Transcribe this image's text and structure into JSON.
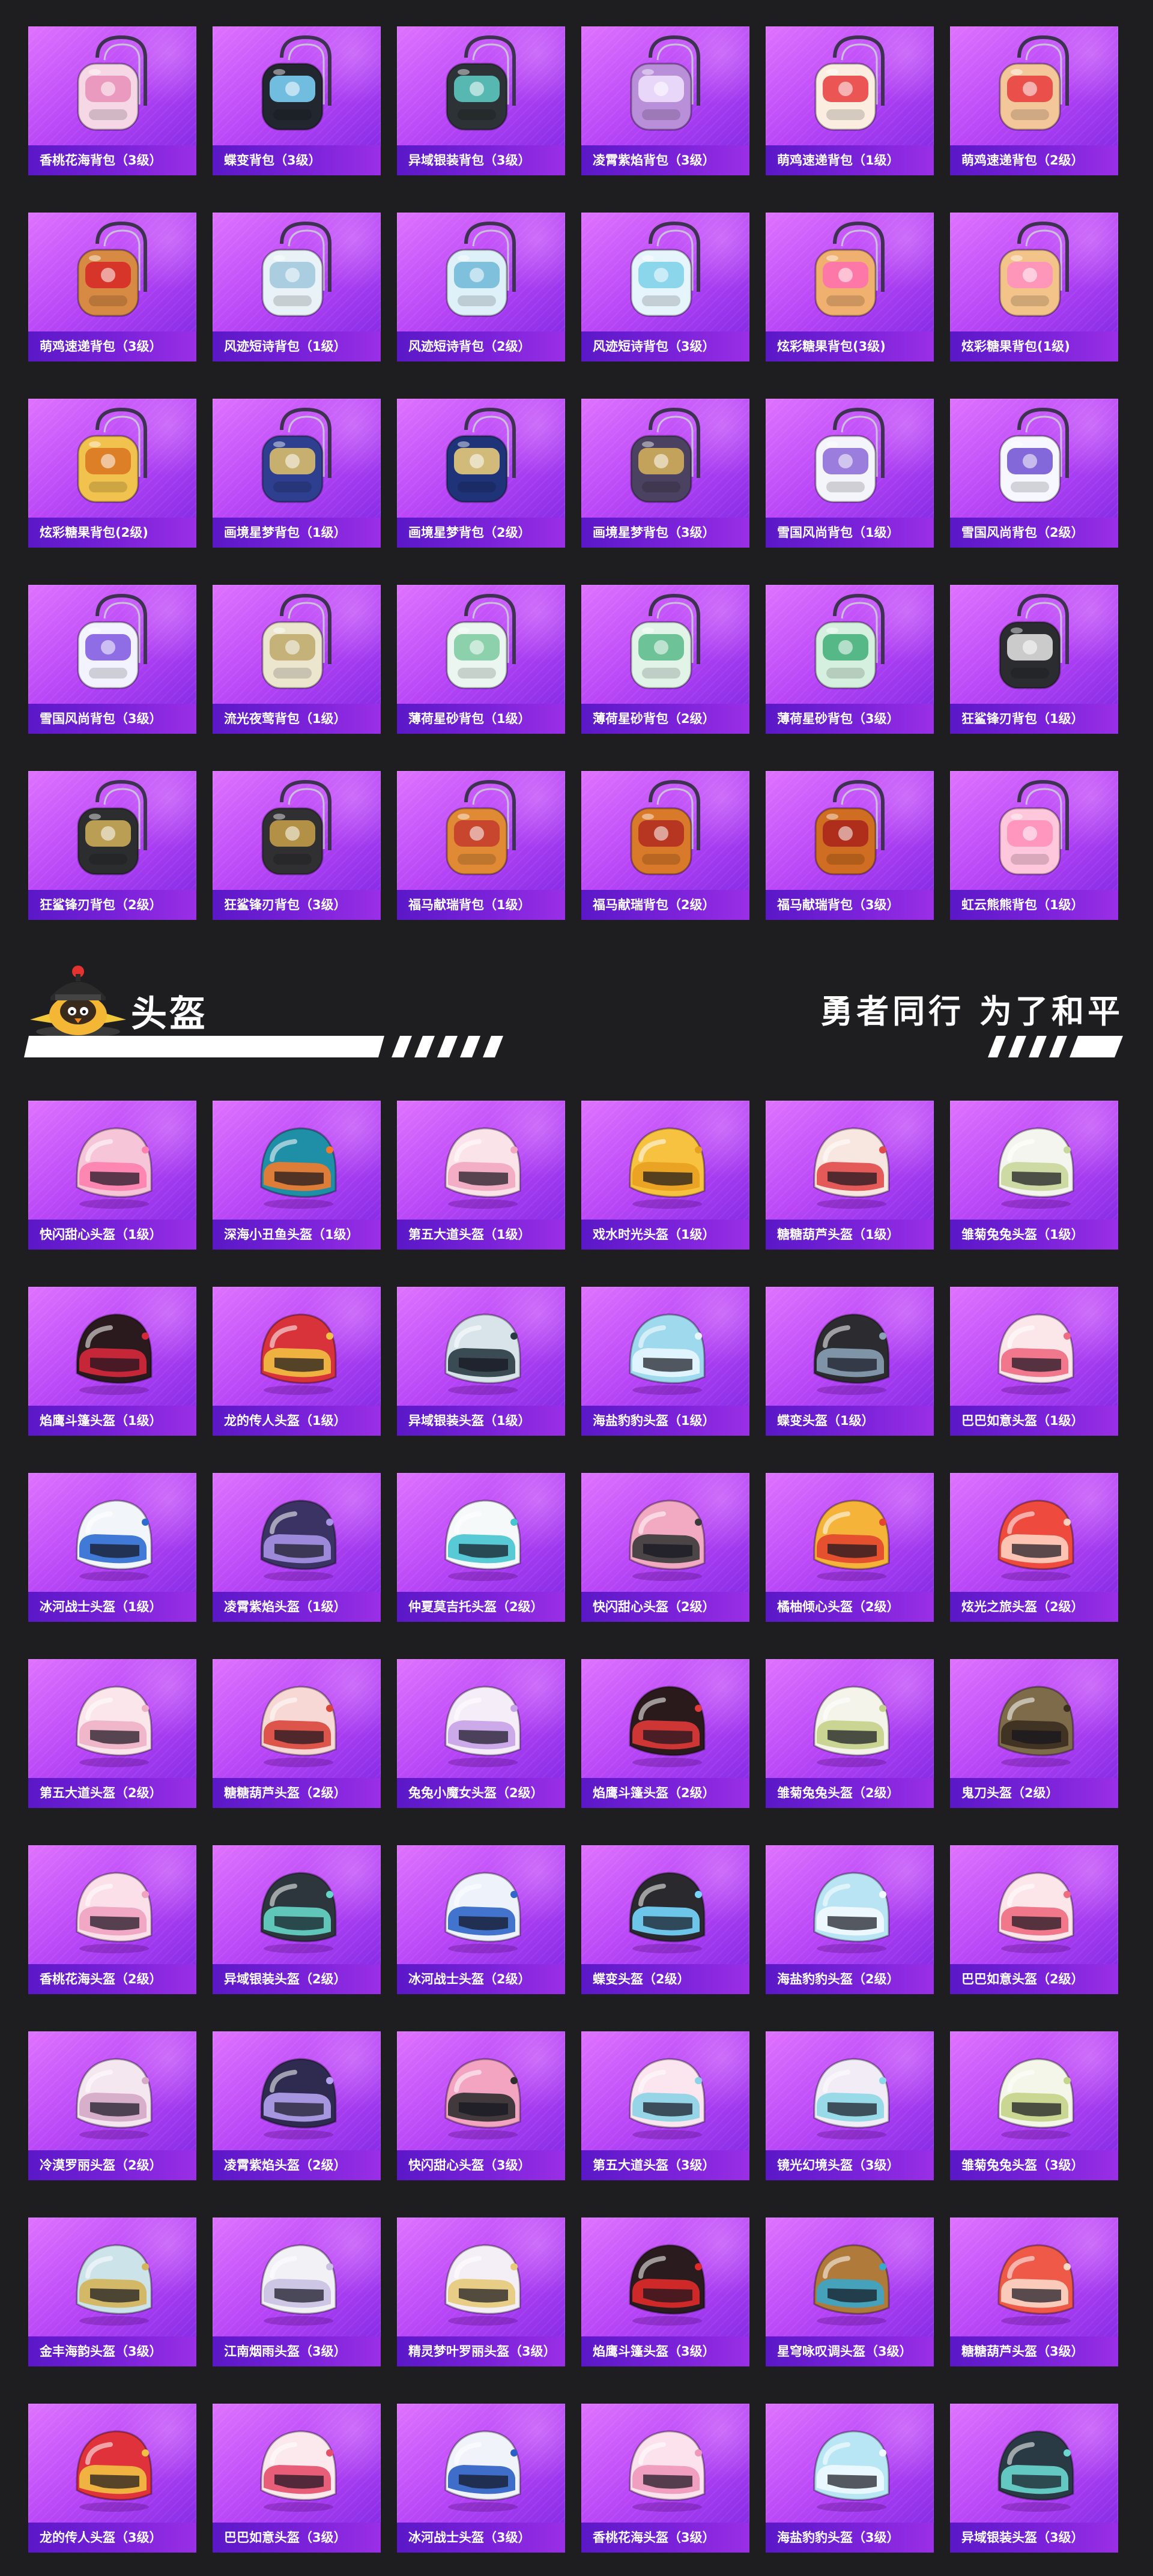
{
  "backpacks": {
    "items": [
      {
        "name": "香桃花海背包（3级）",
        "kind": "backpack",
        "color": "#f6d7e6",
        "accent": "#e98fb7"
      },
      {
        "name": "蝶变背包（3级）",
        "kind": "backpack",
        "color": "#22262e",
        "accent": "#7fd8ff"
      },
      {
        "name": "异域银装背包（3级）",
        "kind": "backpack",
        "color": "#2c3236",
        "accent": "#5fd0c8"
      },
      {
        "name": "凌霄紫焰背包（3级）",
        "kind": "backpack",
        "color": "#b98fd9",
        "accent": "#f1e4ff"
      },
      {
        "name": "萌鸡速递背包（1级）",
        "kind": "backpack",
        "color": "#fbeee0",
        "accent": "#e83b3b"
      },
      {
        "name": "萌鸡速递背包（2级）",
        "kind": "backpack",
        "color": "#f4c79b",
        "accent": "#e83b3b"
      },
      {
        "name": "萌鸡速递背包（3级）",
        "kind": "backpack",
        "color": "#d78a43",
        "accent": "#d82626"
      },
      {
        "name": "风迹短诗背包（1级）",
        "kind": "backpack",
        "color": "#e9f2f6",
        "accent": "#9fc8dc"
      },
      {
        "name": "风迹短诗背包（2级）",
        "kind": "backpack",
        "color": "#dff1f8",
        "accent": "#6fb7d8"
      },
      {
        "name": "风迹短诗背包（3级）",
        "kind": "backpack",
        "color": "#e6f4fb",
        "accent": "#7ad0e8"
      },
      {
        "name": "炫彩糖果背包(3级)",
        "kind": "backpack",
        "color": "#f0b070",
        "accent": "#ff6fb0"
      },
      {
        "name": "炫彩糖果背包(1级)",
        "kind": "backpack",
        "color": "#f3c48a",
        "accent": "#ff8ec2"
      },
      {
        "name": "炫彩糖果背包(2级)",
        "kind": "backpack",
        "color": "#f2c24f",
        "accent": "#d9731f"
      },
      {
        "name": "画境星梦背包（1级）",
        "kind": "backpack",
        "color": "#2e3f8f",
        "accent": "#e2c46a"
      },
      {
        "name": "画境星梦背包（2级）",
        "kind": "backpack",
        "color": "#1f3378",
        "accent": "#f1d27a"
      },
      {
        "name": "画境星梦背包（3级）",
        "kind": "backpack",
        "color": "#4a4260",
        "accent": "#d8b35a"
      },
      {
        "name": "雪国风尚背包（1级）",
        "kind": "backpack",
        "color": "#f4f4fb",
        "accent": "#8a67d6"
      },
      {
        "name": "雪国风尚背包（2级）",
        "kind": "backpack",
        "color": "#f7f7ff",
        "accent": "#6f4fd2"
      },
      {
        "name": "雪国风尚背包（3级）",
        "kind": "backpack",
        "color": "#f3f3ff",
        "accent": "#7c55e0"
      },
      {
        "name": "流光夜莺背包（1级）",
        "kind": "backpack",
        "color": "#ece6cf",
        "accent": "#bda86a"
      },
      {
        "name": "薄荷星砂背包（1级）",
        "kind": "backpack",
        "color": "#eaf6ef",
        "accent": "#7ccaa0"
      },
      {
        "name": "薄荷星砂背包（2级）",
        "kind": "backpack",
        "color": "#e2f4e8",
        "accent": "#59b98a"
      },
      {
        "name": "薄荷星砂背包（3级）",
        "kind": "backpack",
        "color": "#d6f0df",
        "accent": "#3fae78"
      },
      {
        "name": "狂鲨锋刃背包（1级）",
        "kind": "backpack",
        "color": "#2a2c30",
        "accent": "#e8e8e8"
      },
      {
        "name": "狂鲨锋刃背包（2级）",
        "kind": "backpack",
        "color": "#2c2d2f",
        "accent": "#d4b35a"
      },
      {
        "name": "狂鲨锋刃背包（3级）",
        "kind": "backpack",
        "color": "#303033",
        "accent": "#c9a24a"
      },
      {
        "name": "福马献瑞背包（1级）",
        "kind": "backpack",
        "color": "#e08a35",
        "accent": "#c2392b"
      },
      {
        "name": "福马献瑞背包（2级）",
        "kind": "backpack",
        "color": "#d97a2a",
        "accent": "#b02a20"
      },
      {
        "name": "福马献瑞背包（3级）",
        "kind": "backpack",
        "color": "#cf6e22",
        "accent": "#a8221a"
      },
      {
        "name": "虹云熊熊背包（1级）",
        "kind": "backpack",
        "color": "#ffc7dc",
        "accent": "#ff8db8"
      }
    ]
  },
  "section": {
    "title": "头盔",
    "slogan": "勇者同行 为了和平",
    "mascot_icon": "chick-helmet-mascot-icon"
  },
  "helmets": {
    "items": [
      {
        "name": "快闪甜心头盔（1级）",
        "kind": "helmet",
        "color": "#f6c6d8",
        "accent": "#ff7fae"
      },
      {
        "name": "深海小丑鱼头盔（1级）",
        "kind": "helmet",
        "color": "#1f8fa8",
        "accent": "#f27b2a"
      },
      {
        "name": "第五大道头盔（1级）",
        "kind": "helmet",
        "color": "#fbe3ea",
        "accent": "#f2a6c0"
      },
      {
        "name": "戏水时光头盔（1级）",
        "kind": "helmet",
        "color": "#f7c240",
        "accent": "#e8a020"
      },
      {
        "name": "糖糖葫芦头盔（1级）",
        "kind": "helmet",
        "color": "#f8e6e0",
        "accent": "#e04a4a"
      },
      {
        "name": "雏菊兔兔头盔（1级）",
        "kind": "helmet",
        "color": "#f5f5ef",
        "accent": "#c9d79a"
      },
      {
        "name": "焰鹰斗篷头盔（1级）",
        "kind": "helmet",
        "color": "#2a1a1e",
        "accent": "#d6283b"
      },
      {
        "name": "龙的传人头盔（1级）",
        "kind": "helmet",
        "color": "#d8323a",
        "accent": "#f2c043"
      },
      {
        "name": "异域银装头盔（1级）",
        "kind": "helmet",
        "color": "#d8e4ea",
        "accent": "#2a3a44"
      },
      {
        "name": "海盐豹豹头盔（1级）",
        "kind": "helmet",
        "color": "#9fd9ee",
        "accent": "#e6f6ff"
      },
      {
        "name": "蝶变头盔（1级）",
        "kind": "helmet",
        "color": "#2b2b30",
        "accent": "#8aa0b5"
      },
      {
        "name": "巴巴如意头盔（1级）",
        "kind": "helmet",
        "color": "#fbe7ea",
        "accent": "#ef6a82"
      },
      {
        "name": "冰河战士头盔（1级）",
        "kind": "helmet",
        "color": "#f2f6fb",
        "accent": "#2e6bd1"
      },
      {
        "name": "凌霄紫焰头盔（1级）",
        "kind": "helmet",
        "color": "#3a3363",
        "accent": "#a892e6"
      },
      {
        "name": "仲夏莫吉托头盔（2级）",
        "kind": "helmet",
        "color": "#f5f9fa",
        "accent": "#46c4d0"
      },
      {
        "name": "快闪甜心头盔（2级）",
        "kind": "helmet",
        "color": "#f2a9c2",
        "accent": "#3a3a3a"
      },
      {
        "name": "橘柚倾心头盔（2级）",
        "kind": "helmet",
        "color": "#f6b33a",
        "accent": "#e3462f"
      },
      {
        "name": "炫光之旅头盔（2级）",
        "kind": "helmet",
        "color": "#ef4a3e",
        "accent": "#ffd2c0"
      },
      {
        "name": "第五大道头盔（2级）",
        "kind": "helmet",
        "color": "#fbe6ec",
        "accent": "#eeb0c5"
      },
      {
        "name": "糖糖葫芦头盔（2级）",
        "kind": "helmet",
        "color": "#f7d8d5",
        "accent": "#d9463c"
      },
      {
        "name": "兔兔小魔女头盔（2级）",
        "kind": "helmet",
        "color": "#f5eef8",
        "accent": "#c8a2e8"
      },
      {
        "name": "焰鹰斗篷头盔（2级）",
        "kind": "helmet",
        "color": "#2a1a1c",
        "accent": "#e03a3a"
      },
      {
        "name": "雏菊兔兔头盔（2级）",
        "kind": "helmet",
        "color": "#f4f4ea",
        "accent": "#c5d08a"
      },
      {
        "name": "鬼刀头盔（2级）",
        "kind": "helmet",
        "color": "#7d6b4a",
        "accent": "#3a2e1f"
      },
      {
        "name": "香桃花海头盔（2级）",
        "kind": "helmet",
        "color": "#fbe0ea",
        "accent": "#f0a2c0"
      },
      {
        "name": "异域银装头盔（2级）",
        "kind": "helmet",
        "color": "#2c363c",
        "accent": "#66d6c8"
      },
      {
        "name": "冰河战士头盔（2级）",
        "kind": "helmet",
        "color": "#eef3fb",
        "accent": "#2f66c9"
      },
      {
        "name": "蝶变头盔（2级）",
        "kind": "helmet",
        "color": "#2a2a2e",
        "accent": "#76d6ff"
      },
      {
        "name": "海盐豹豹头盔（2级）",
        "kind": "helmet",
        "color": "#b8e4f4",
        "accent": "#f2f9ff"
      },
      {
        "name": "巴巴如意头盔（2级）",
        "kind": "helmet",
        "color": "#fde6ea",
        "accent": "#f06a80"
      },
      {
        "name": "冷漠罗丽头盔（2级）",
        "kind": "helmet",
        "color": "#f4e7ef",
        "accent": "#d5a9c6"
      },
      {
        "name": "凌霄紫焰头盔（2级）",
        "kind": "helmet",
        "color": "#2e2a50",
        "accent": "#b4a2f0"
      },
      {
        "name": "快闪甜心头盔（3级）",
        "kind": "helmet",
        "color": "#f3a4c1",
        "accent": "#2e2e2e"
      },
      {
        "name": "第五大道头盔（3级）",
        "kind": "helmet",
        "color": "#fbe5ee",
        "accent": "#8bd2e6"
      },
      {
        "name": "镜光幻境头盔（3级）",
        "kind": "helmet",
        "color": "#f1ecf6",
        "accent": "#8fd8e8"
      },
      {
        "name": "雏菊兔兔头盔（3级）",
        "kind": "helmet",
        "color": "#f3f6e8",
        "accent": "#c4d488"
      },
      {
        "name": "金丰海韵头盔（3级）",
        "kind": "helmet",
        "color": "#cde3ea",
        "accent": "#d4b35a"
      },
      {
        "name": "江南烟雨头盔（3级）",
        "kind": "helmet",
        "color": "#f2f1f6",
        "accent": "#c9c2e3"
      },
      {
        "name": "精灵梦叶罗丽头盔（3级）",
        "kind": "helmet",
        "color": "#f4eff6",
        "accent": "#e6c979"
      },
      {
        "name": "焰鹰斗篷头盔（3级）",
        "kind": "helmet",
        "color": "#2a1c1e",
        "accent": "#e02a2a"
      },
      {
        "name": "星穹咏叹调头盔（3级）",
        "kind": "helmet",
        "color": "#b07a3a",
        "accent": "#3aa6c9"
      },
      {
        "name": "糖糖葫芦头盔（3级）",
        "kind": "helmet",
        "color": "#ef5a48",
        "accent": "#fbd7c8"
      },
      {
        "name": "龙的传人头盔（3级）",
        "kind": "helmet",
        "color": "#e0323a",
        "accent": "#f2c043"
      },
      {
        "name": "巴巴如意头盔（3级）",
        "kind": "helmet",
        "color": "#fbe9ee",
        "accent": "#e64e6a"
      },
      {
        "name": "冰河战士头盔（3级）",
        "kind": "helmet",
        "color": "#f0f4fa",
        "accent": "#2a5fc3"
      },
      {
        "name": "香桃花海头盔（3级）",
        "kind": "helmet",
        "color": "#fbe2ec",
        "accent": "#ef98bb"
      },
      {
        "name": "海盐豹豹头盔（3级）",
        "kind": "helmet",
        "color": "#b9e6f5",
        "accent": "#eef9ff"
      },
      {
        "name": "异域银装头盔（3级）",
        "kind": "helmet",
        "color": "#2a3a44",
        "accent": "#6ad8d0"
      }
    ]
  }
}
